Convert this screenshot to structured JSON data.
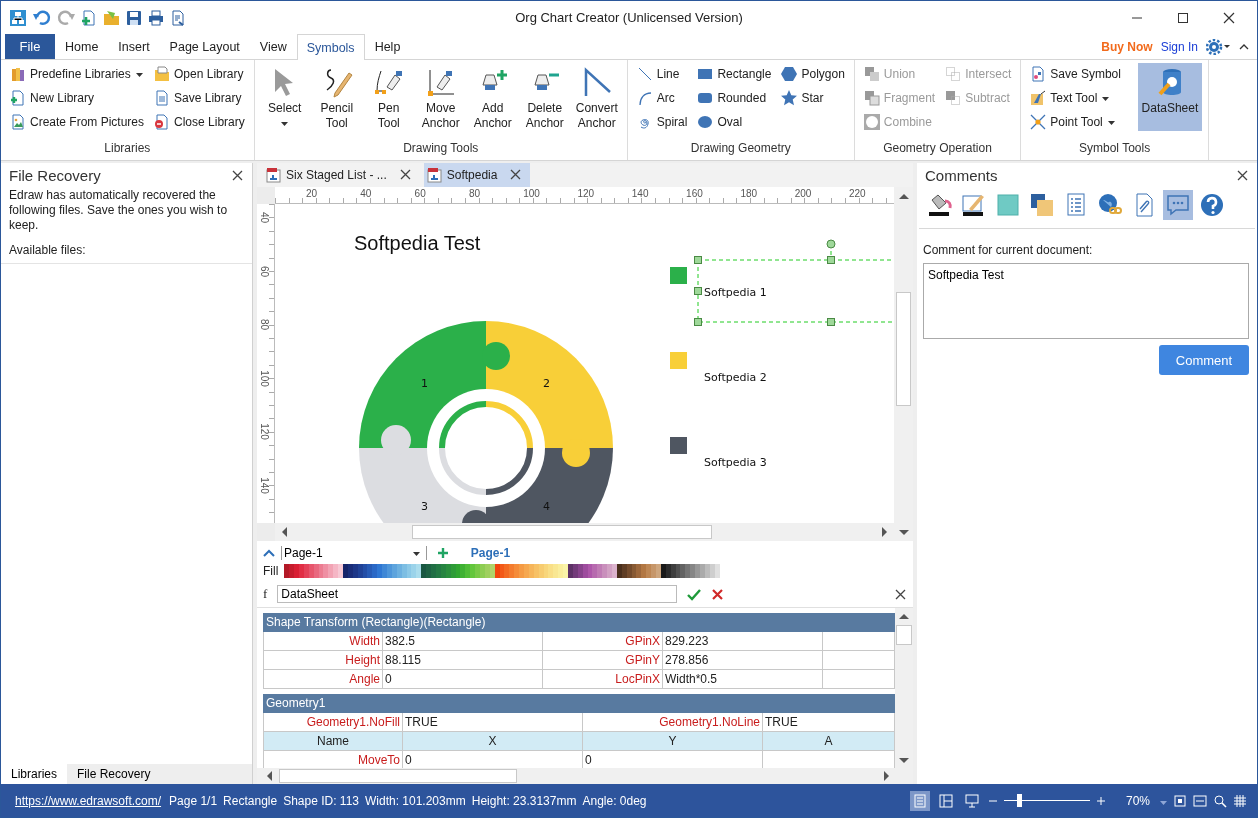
{
  "title_bar": {
    "title": "Org Chart Creator (Unlicensed Version)"
  },
  "menu": {
    "file": "File",
    "tabs": [
      {
        "label": "Home",
        "selected": false
      },
      {
        "label": "Insert",
        "selected": false
      },
      {
        "label": "Page Layout",
        "selected": false
      },
      {
        "label": "View",
        "selected": false
      },
      {
        "label": "Symbols",
        "selected": true
      },
      {
        "label": "Help",
        "selected": false
      }
    ],
    "buy_now": "Buy Now",
    "sign_in": "Sign In"
  },
  "ribbon": [
    {
      "label": "Libraries",
      "items": [
        {
          "kind": "small",
          "label": "Predefine Libraries",
          "dropdown": true,
          "disabled": false,
          "selected": false
        },
        {
          "kind": "small",
          "label": "New Library",
          "dropdown": false,
          "disabled": false,
          "selected": false
        },
        {
          "kind": "small",
          "label": "Create From Pictures",
          "dropdown": false,
          "disabled": false,
          "selected": false
        },
        {
          "kind": "small",
          "label": "Open Library",
          "dropdown": false,
          "disabled": false,
          "selected": false
        },
        {
          "kind": "small",
          "label": "Save Library",
          "dropdown": false,
          "disabled": false,
          "selected": false
        },
        {
          "kind": "small",
          "label": "Close Library",
          "dropdown": false,
          "disabled": false,
          "selected": false
        }
      ]
    },
    {
      "label": "Drawing Tools",
      "items": [
        {
          "kind": "large",
          "label": "Select",
          "dropdown": true,
          "disabled": false,
          "selected": false
        },
        {
          "kind": "large",
          "label": "Pencil Tool",
          "dropdown": false,
          "disabled": false,
          "selected": false
        },
        {
          "kind": "large",
          "label": "Pen Tool",
          "dropdown": false,
          "disabled": false,
          "selected": false
        },
        {
          "kind": "large",
          "label": "Move Anchor",
          "dropdown": false,
          "disabled": false,
          "selected": false
        },
        {
          "kind": "large",
          "label": "Add Anchor",
          "dropdown": false,
          "disabled": false,
          "selected": false
        },
        {
          "kind": "large",
          "label": "Delete Anchor",
          "dropdown": false,
          "disabled": false,
          "selected": false
        },
        {
          "kind": "large",
          "label": "Convert Anchor",
          "dropdown": false,
          "disabled": false,
          "selected": false
        }
      ]
    },
    {
      "label": "Drawing Geometry",
      "items": [
        {
          "kind": "small",
          "label": "Line",
          "dropdown": false,
          "disabled": false,
          "selected": false
        },
        {
          "kind": "small",
          "label": "Arc",
          "dropdown": false,
          "disabled": false,
          "selected": false
        },
        {
          "kind": "small",
          "label": "Spiral",
          "dropdown": false,
          "disabled": false,
          "selected": false
        },
        {
          "kind": "small",
          "label": "Rectangle",
          "dropdown": false,
          "disabled": false,
          "selected": false
        },
        {
          "kind": "small",
          "label": "Rounded",
          "dropdown": false,
          "disabled": false,
          "selected": false
        },
        {
          "kind": "small",
          "label": "Oval",
          "dropdown": false,
          "disabled": false,
          "selected": false
        },
        {
          "kind": "small",
          "label": "Polygon",
          "dropdown": false,
          "disabled": false,
          "selected": false
        },
        {
          "kind": "small",
          "label": "Star",
          "dropdown": false,
          "disabled": false,
          "selected": false
        }
      ]
    },
    {
      "label": "Geometry Operation",
      "items": [
        {
          "kind": "small",
          "label": "Union",
          "dropdown": false,
          "disabled": true,
          "selected": false
        },
        {
          "kind": "small",
          "label": "Fragment",
          "dropdown": false,
          "disabled": true,
          "selected": false
        },
        {
          "kind": "small",
          "label": "Combine",
          "dropdown": false,
          "disabled": true,
          "selected": false
        },
        {
          "kind": "small",
          "label": "Intersect",
          "dropdown": false,
          "disabled": true,
          "selected": false
        },
        {
          "kind": "small",
          "label": "Subtract",
          "dropdown": false,
          "disabled": true,
          "selected": false
        }
      ]
    },
    {
      "label": "Symbol Tools",
      "items": [
        {
          "kind": "small",
          "label": "Save Symbol",
          "dropdown": false,
          "disabled": false,
          "selected": false
        },
        {
          "kind": "small",
          "label": "Text Tool",
          "dropdown": true,
          "disabled": false,
          "selected": false
        },
        {
          "kind": "small",
          "label": "Point Tool",
          "dropdown": true,
          "disabled": false,
          "selected": false
        },
        {
          "kind": "large",
          "label": "DataSheet",
          "dropdown": false,
          "disabled": false,
          "selected": true
        }
      ]
    }
  ],
  "left_panel": {
    "title": "File Recovery",
    "message": "Edraw has automatically recovered the following files. Save the ones you wish to keep.",
    "list_label": "Available files:",
    "tabs": [
      {
        "label": "Libraries",
        "selected": true
      },
      {
        "label": "File Recovery",
        "selected": false
      }
    ]
  },
  "documents": [
    {
      "label": "Six Staged List - ...",
      "selected": false
    },
    {
      "label": "Softpedia",
      "selected": true
    }
  ],
  "canvas": {
    "ruler_h": [
      "20",
      "40",
      "60",
      "80",
      "100",
      "120",
      "140",
      "160",
      "180",
      "200",
      "220"
    ],
    "ruler_v": [
      "40",
      "60",
      "80",
      "100",
      "120",
      "140"
    ],
    "title": "Softpedia Test",
    "segments": [
      {
        "label": "1",
        "color": "#2bb04a"
      },
      {
        "label": "2",
        "color": "#f8cf38"
      },
      {
        "label": "3",
        "color": "#dcdde1"
      },
      {
        "label": "4",
        "color": "#4f5661"
      }
    ],
    "legend": [
      {
        "label": "Softpedia 1",
        "color": "#2bb04a",
        "selected": true
      },
      {
        "label": "Softpedia 2",
        "color": "#f8cf38",
        "selected": false
      },
      {
        "label": "Softpedia 3",
        "color": "#4f5661",
        "selected": false
      }
    ]
  },
  "page_bar": {
    "page_select": "Page-1",
    "pages": [
      {
        "label": "Page-1",
        "selected": true
      }
    ],
    "fill_label": "Fill"
  },
  "formula": {
    "label": "f",
    "value": "DataSheet"
  },
  "datasheet": {
    "sections": [
      {
        "kind": "transform",
        "title": "Shape Transform (Rectangle)(Rectangle)",
        "rows": [
          [
            {
              "kind": "label",
              "text": "Width"
            },
            {
              "kind": "value",
              "text": "382.5"
            },
            {
              "kind": "label",
              "text": "GPinX"
            },
            {
              "kind": "value",
              "text": "829.223"
            }
          ],
          [
            {
              "kind": "label",
              "text": "Height"
            },
            {
              "kind": "value",
              "text": "88.115"
            },
            {
              "kind": "label",
              "text": "GPinY"
            },
            {
              "kind": "value",
              "text": "278.856"
            }
          ],
          [
            {
              "kind": "label",
              "text": "Angle"
            },
            {
              "kind": "value",
              "text": "0"
            },
            {
              "kind": "label",
              "text": "LocPinX"
            },
            {
              "kind": "value",
              "text": "Width*0.5"
            }
          ]
        ]
      },
      {
        "kind": "geometry",
        "title": "Geometry1",
        "rows": [
          [
            {
              "kind": "label",
              "text": "Geometry1.NoFill"
            },
            {
              "kind": "value",
              "text": "TRUE"
            },
            {
              "kind": "label",
              "text": "Geometry1.NoLine"
            },
            {
              "kind": "value",
              "text": "TRUE"
            }
          ],
          [
            {
              "kind": "header",
              "text": "Name"
            },
            {
              "kind": "header",
              "text": "X"
            },
            {
              "kind": "header",
              "text": "Y"
            },
            {
              "kind": "header",
              "text": "A"
            }
          ],
          [
            {
              "kind": "label",
              "text": "MoveTo"
            },
            {
              "kind": "value",
              "text": "0"
            },
            {
              "kind": "value",
              "text": "0"
            }
          ]
        ]
      }
    ]
  },
  "comments": {
    "title": "Comments",
    "tools": [
      {
        "selected": false
      },
      {
        "selected": false
      },
      {
        "selected": false
      },
      {
        "selected": false
      },
      {
        "selected": false
      },
      {
        "selected": false
      },
      {
        "selected": false
      },
      {
        "selected": true
      },
      {
        "selected": false
      }
    ],
    "label": "Comment for current document:",
    "value": "Softpedia Test",
    "button": "Comment"
  },
  "status_bar": {
    "link": "https://www.edrawsoft.com/",
    "items": [
      "Page 1/1",
      "Rectangle",
      "Shape ID: 113",
      "Width: 101.203mm",
      "Height: 23.3137mm",
      "Angle: 0deg"
    ],
    "views": [
      {
        "selected": true
      },
      {
        "selected": false
      },
      {
        "selected": false
      }
    ],
    "zoom": {
      "level": 0.15,
      "reading": "70%"
    }
  }
}
